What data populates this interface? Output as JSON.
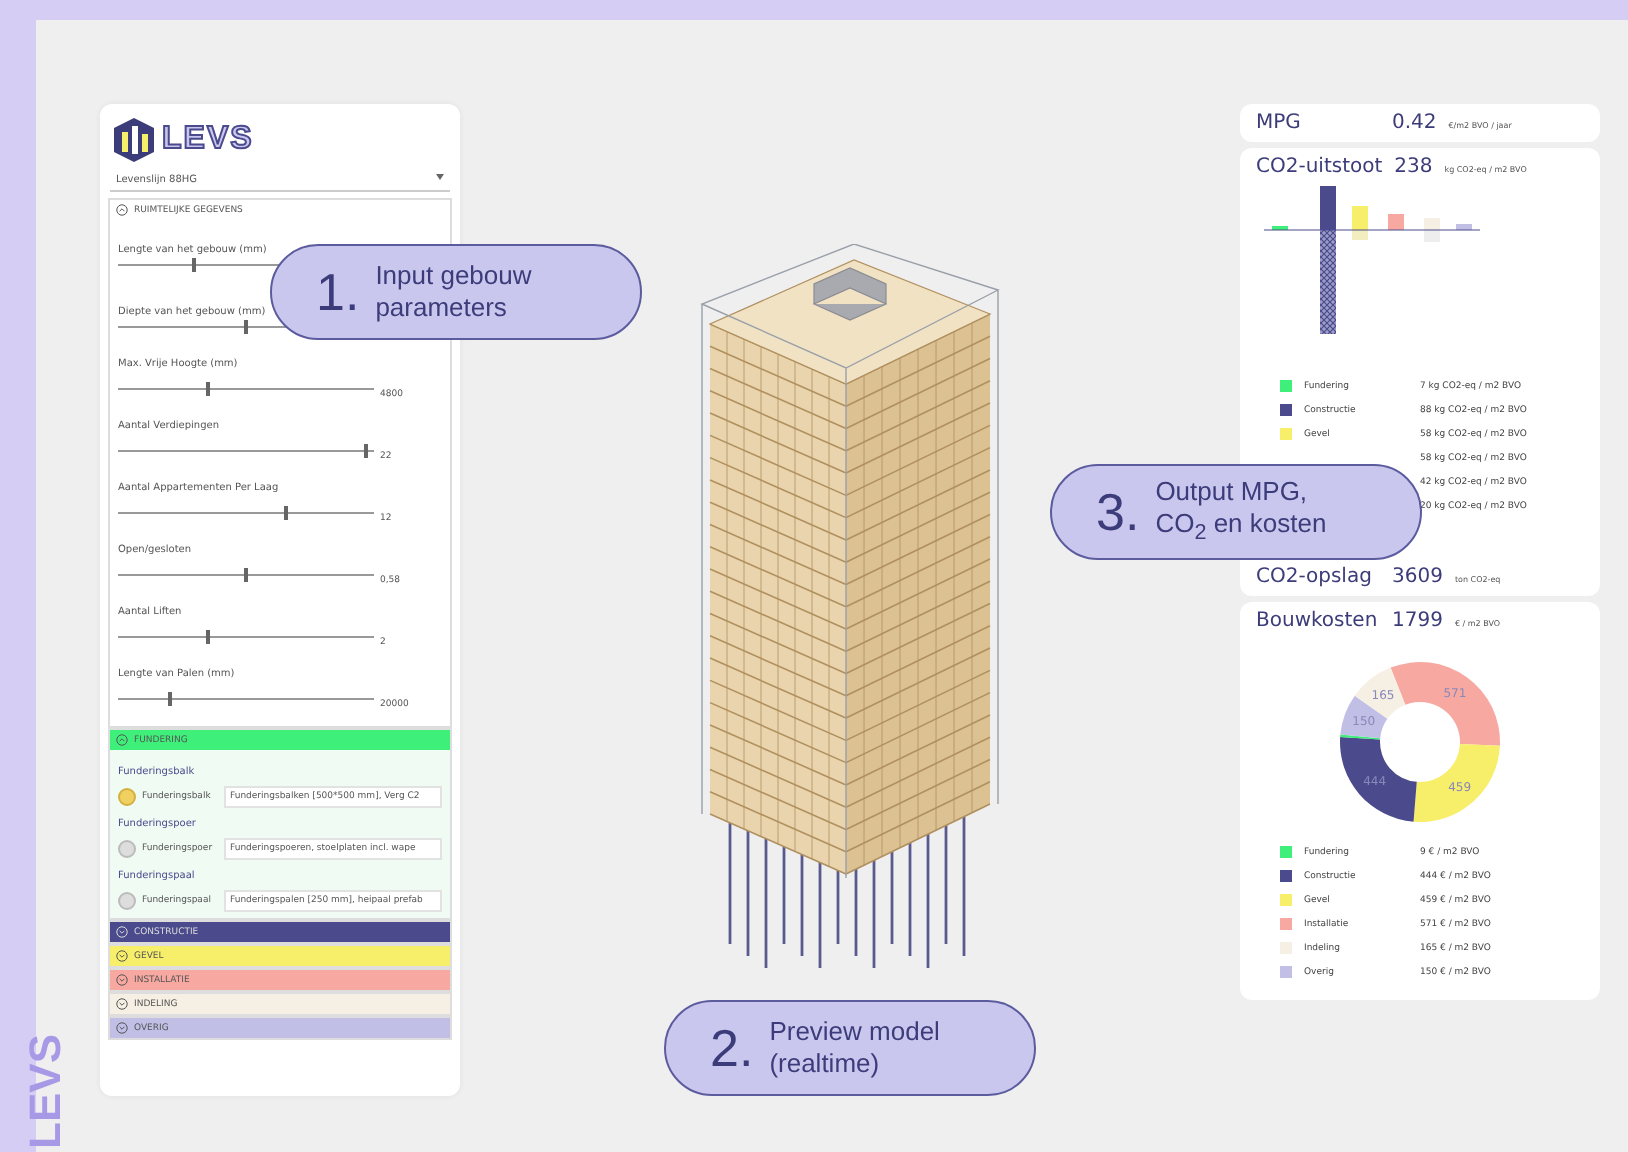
{
  "side_label": "LEVS",
  "logo": {
    "text": "LEVS"
  },
  "dropdown": {
    "value": "Levenslijn 88HG"
  },
  "sections": [
    {
      "title": "RUIMTELIJKE GEGEVENS",
      "expanded": true,
      "color": "#ffffff",
      "kind": "sliders",
      "sliders": [
        {
          "label": "Lengte van het gebouw (mm)",
          "level": 0.3
        },
        {
          "label": "Diepte van het gebouw (mm)",
          "level": 0.5
        },
        {
          "label": "Max. Vrije Hoogte (mm)",
          "level": 0.35,
          "reading": "4800"
        },
        {
          "label": "Aantal Verdiepingen",
          "level": 0.97,
          "reading": "22"
        },
        {
          "label": "Aantal Appartementen Per Laag",
          "level": 0.66,
          "reading": "12"
        },
        {
          "label": "Open/gesloten",
          "level": 0.5,
          "reading": "0,58"
        },
        {
          "label": "Aantal Liften",
          "level": 0.35,
          "reading": "2"
        },
        {
          "label": "Lengte van Palen (mm)",
          "level": 0.2,
          "reading": "20000"
        }
      ]
    },
    {
      "title": "FUNDERING",
      "expanded": true,
      "color": "#3ef07a",
      "kind": "options",
      "groups": [
        {
          "heading": "Funderingsbalk",
          "option": "Funderingsbalk",
          "selected": true,
          "field": "Funderingsbalken [500*500 mm], Verg C2"
        },
        {
          "heading": "Funderingspoer",
          "option": "Funderingspoer",
          "selected": false,
          "field": "Funderingspoeren, stoelplaten incl. wape"
        },
        {
          "heading": "Funderingspaal",
          "option": "Funderingspaal",
          "selected": false,
          "field": "Funderingspalen [250 mm], heipaal prefab"
        }
      ]
    },
    {
      "title": "CONSTRUCTIE",
      "expanded": false,
      "color": "#4a4a8c",
      "kind": "closed"
    },
    {
      "title": "GEVEL",
      "expanded": false,
      "color": "#f7ef6a",
      "kind": "closed"
    },
    {
      "title": "INSTALLATIE",
      "expanded": false,
      "color": "#f7a9a1",
      "kind": "closed"
    },
    {
      "title": "INDELING",
      "expanded": false,
      "color": "#f6efe3",
      "kind": "closed"
    },
    {
      "title": "OVERIG",
      "expanded": false,
      "color": "#c1bfe6",
      "kind": "closed"
    }
  ],
  "callouts": [
    {
      "number": "1.",
      "lines": [
        "Input gebouw",
        "parameters"
      ],
      "kind": "input"
    },
    {
      "number": "2.",
      "lines": [
        "Preview model",
        "(realtime)"
      ],
      "kind": "preview"
    },
    {
      "number": "3.",
      "lines": [
        "Output MPG,",
        "CO$_{2}$ en kosten"
      ],
      "kind": "output"
    }
  ],
  "mpg": {
    "label": "MPG",
    "value": "0.42",
    "unit": "€/m2 BVO / jaar"
  },
  "co2": {
    "label": "CO2-uitstoot",
    "value": "238",
    "unit": "kg CO2-eq / m2 BVO",
    "legend": [
      {
        "label": "Fundering",
        "value": "7 kg CO2-eq / m2 BVO",
        "color": "#3ef07a"
      },
      {
        "label": "Constructie",
        "value": "88 kg CO2-eq / m2 BVO",
        "color": "#4a4a8c"
      },
      {
        "label": "Gevel",
        "value": "58 kg CO2-eq / m2 BVO",
        "color": "#f7ef6a"
      },
      {
        "value": "58 kg CO2-eq / m2 BVO"
      },
      {
        "value": "42 kg CO2-eq / m2 BVO"
      },
      {
        "value": "20 kg CO2-eq / m2 BVO"
      }
    ]
  },
  "co2_storage": {
    "label": "CO2-opslag",
    "value": "3609",
    "unit": "ton CO2-eq"
  },
  "costs": {
    "label": "Bouwkosten",
    "value": "1799",
    "unit": "€ / m2 BVO",
    "chart_data": {
      "type": "donut",
      "values": [
        571,
        459,
        444,
        9,
        150,
        165
      ],
      "value_labels": [
        "571",
        "459",
        "444",
        null,
        "150",
        "165"
      ]
    },
    "legend": [
      {
        "label": "Fundering",
        "value": "9 € / m2 BVO",
        "color": "#3ef07a"
      },
      {
        "label": "Constructie",
        "value": "444 € / m2 BVO",
        "color": "#4a4a8c"
      },
      {
        "label": "Gevel",
        "value": "459 € / m2 BVO",
        "color": "#f7ef6a"
      },
      {
        "label": "Installatie",
        "value": "571 € / m2 BVO",
        "color": "#f7a9a1"
      },
      {
        "label": "Indeling",
        "value": "165 € / m2 BVO",
        "color": "#f6efe3"
      },
      {
        "label": "Overig",
        "value": "150 € / m2 BVO",
        "color": "#c1bfe6"
      }
    ]
  }
}
